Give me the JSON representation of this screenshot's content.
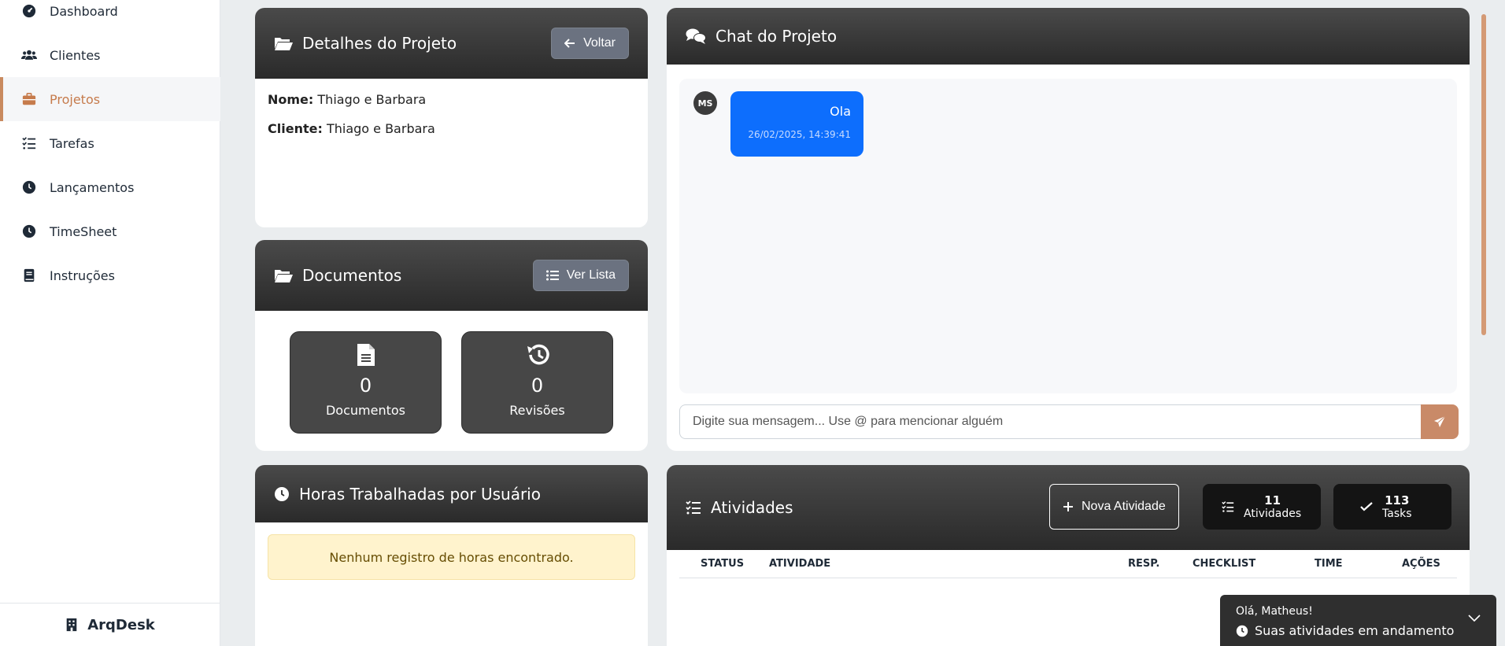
{
  "sidebar": {
    "items": [
      {
        "label": "Dashboard",
        "icon": "gauge-icon"
      },
      {
        "label": "Clientes",
        "icon": "users-icon"
      },
      {
        "label": "Projetos",
        "icon": "briefcase-icon",
        "active": true
      },
      {
        "label": "Tarefas",
        "icon": "list-check-icon"
      },
      {
        "label": "Lançamentos",
        "icon": "clock-icon"
      },
      {
        "label": "TimeSheet",
        "icon": "clock-icon"
      },
      {
        "label": "Instruções",
        "icon": "book-icon"
      }
    ],
    "footer": {
      "brand": "ArqDesk",
      "icon": "building-icon"
    }
  },
  "project_details": {
    "title": "Detalhes do Projeto",
    "back_label": "Voltar",
    "name_label": "Nome:",
    "name_value": "Thiago e Barbara",
    "client_label": "Cliente:",
    "client_value": "Thiago e Barbara"
  },
  "documents": {
    "title": "Documentos",
    "list_label": "Ver Lista",
    "tiles": [
      {
        "count": "0",
        "label": "Documentos",
        "icon": "file-icon"
      },
      {
        "count": "0",
        "label": "Revisões",
        "icon": "history-icon"
      }
    ]
  },
  "hours": {
    "title": "Horas Trabalhadas por Usuário",
    "empty_message": "Nenhum registro de horas encontrado."
  },
  "chat": {
    "title": "Chat do Projeto",
    "messages": [
      {
        "avatar": "MS",
        "text": "Ola",
        "time": "26/02/2025, 14:39:41"
      }
    ],
    "input_placeholder": "Digite sua mensagem... Use @ para mencionar alguém"
  },
  "activities": {
    "title": "Atividades",
    "new_label": "Nova Atividade",
    "activities_count": "11",
    "activities_label": "Atividades",
    "tasks_count": "113",
    "tasks_label": "Tasks",
    "columns": [
      "STATUS",
      "ATIVIDADE",
      "RESP.",
      "CHECKLIST",
      "TIME",
      "AÇÕES"
    ]
  },
  "toast": {
    "greeting": "Olá, Matheus!",
    "message": "Suas atividades em andamento"
  },
  "colors": {
    "accent": "#c67b4c",
    "primary_blue": "#0d6efd",
    "header_dark": "#2a2a2a"
  }
}
